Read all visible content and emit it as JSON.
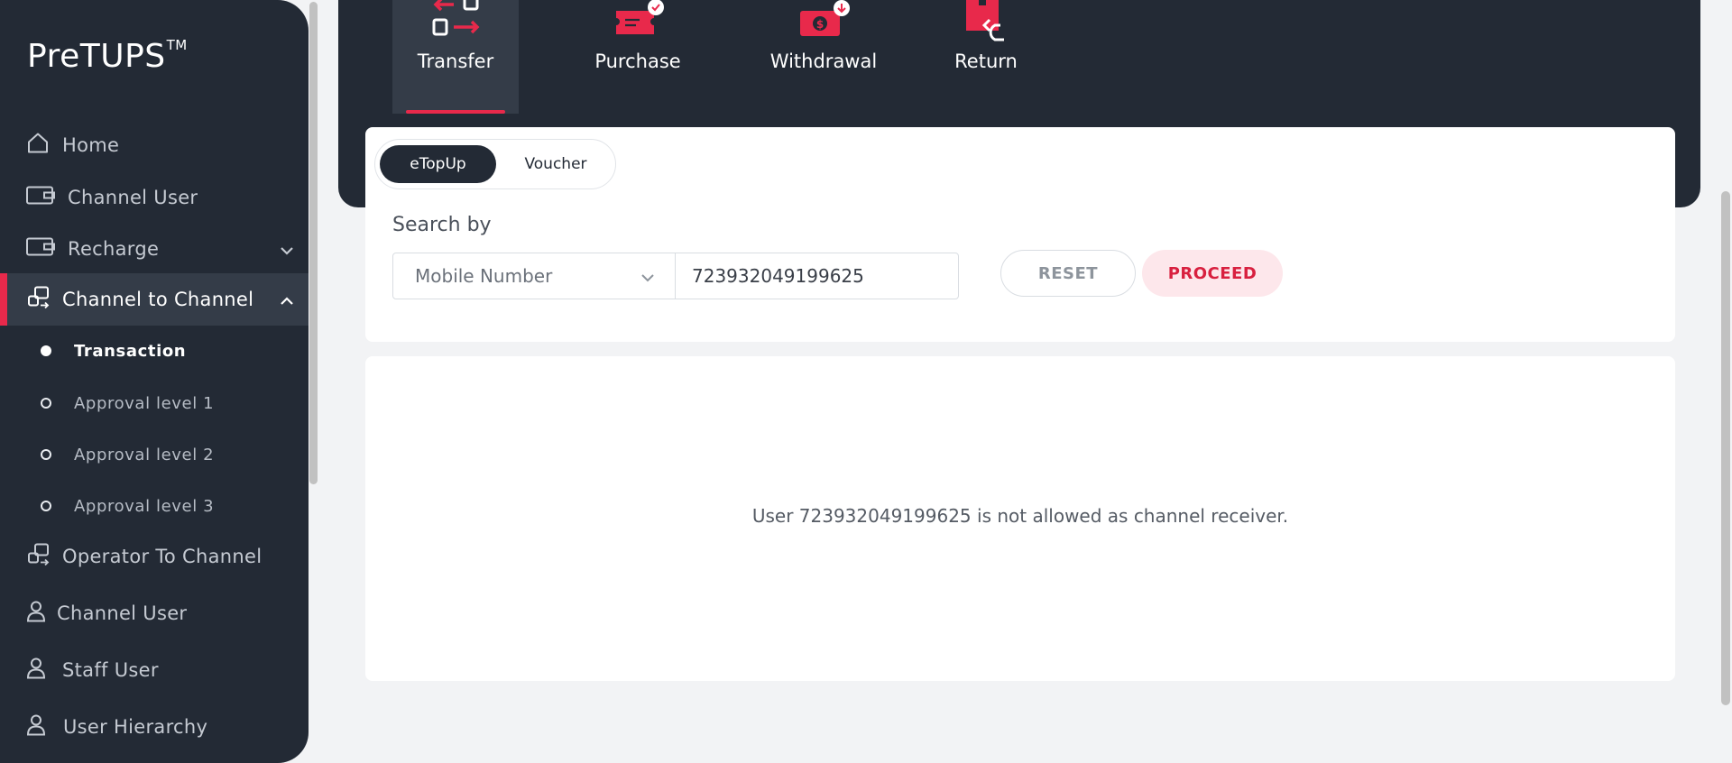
{
  "brand": {
    "name": "PreTUPS",
    "tm": "TM"
  },
  "sidebar": {
    "items": [
      {
        "label": "Home",
        "icon": "home-icon"
      },
      {
        "label": "Channel User",
        "icon": "wallet-icon"
      },
      {
        "label": "Recharge",
        "icon": "wallet-icon"
      },
      {
        "label": "Channel to Channel",
        "icon": "transfer-users-icon"
      },
      {
        "label": "Operator To Channel",
        "icon": "transfer-users-icon"
      },
      {
        "label": "Channel User",
        "icon": "user-icon"
      },
      {
        "label": "Staff User",
        "icon": "user-icon"
      },
      {
        "label": "User Hierarchy",
        "icon": "user-icon"
      }
    ],
    "subitems": [
      {
        "label": "Transaction"
      },
      {
        "label": "Approval level 1"
      },
      {
        "label": "Approval level 2"
      },
      {
        "label": "Approval level 3"
      }
    ]
  },
  "top_tabs": [
    {
      "label": "Transfer",
      "icon": "transfer-arrows-icon"
    },
    {
      "label": "Purchase",
      "icon": "ticket-check-icon"
    },
    {
      "label": "Withdrawal",
      "icon": "money-withdraw-icon"
    },
    {
      "label": "Return",
      "icon": "return-box-icon"
    }
  ],
  "toggle": {
    "option1": "eTopUp",
    "option2": "Voucher"
  },
  "search": {
    "label": "Search by",
    "select_value": "Mobile Number",
    "input_value": "723932049199625",
    "reset_label": "RESET",
    "proceed_label": "PROCEED"
  },
  "result": {
    "message": "User 723932049199625 is not allowed as channel receiver."
  },
  "colors": {
    "sidebar_bg": "#232a35",
    "accent": "#e8294b",
    "active_bg": "#343c48"
  }
}
